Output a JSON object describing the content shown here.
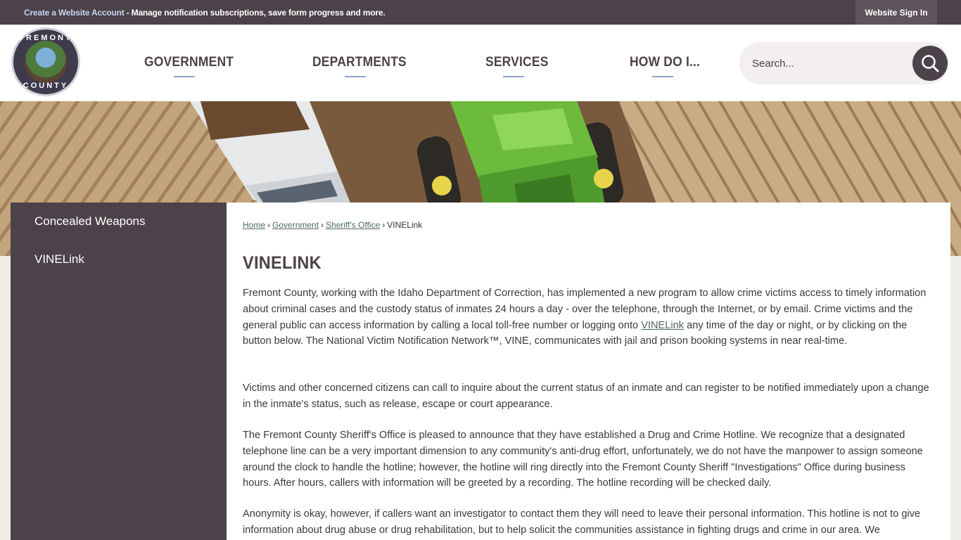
{
  "topbar": {
    "account_link": "Create a Website Account",
    "account_rest": " - Manage notification subscriptions, save form progress and more.",
    "signin_label": "Website Sign In"
  },
  "logo": {
    "top_text": "FREMONT",
    "bottom_text": "COUNTY"
  },
  "nav": {
    "items": [
      {
        "label": "GOVERNMENT"
      },
      {
        "label": "DEPARTMENTS"
      },
      {
        "label": "SERVICES"
      },
      {
        "label": "HOW DO I..."
      }
    ]
  },
  "search": {
    "placeholder": "Search..."
  },
  "sidebar": {
    "items": [
      {
        "label": "Concealed Weapons"
      },
      {
        "label": "VINELink"
      }
    ]
  },
  "breadcrumb": {
    "home": "Home",
    "government": "Government",
    "sheriffs_office": "Sheriff's Office",
    "current": "VINELink",
    "separator": "›"
  },
  "page": {
    "title": "VINELINK",
    "p1_a": "Fremont County, working with the Idaho Department of Correction, has implemented a new program to allow crime victims access to timely information about criminal cases and the custody status of inmates 24 hours a day - over the telephone, through the Internet, or by email. Crime victims and the general public can access information by calling a local toll-free number or logging onto ",
    "p1_link": "VINELink",
    "p1_b": " any time of the day or night, or by clicking on the button below. The National Victim Notification Network™, VINE, communicates with jail and prison booking systems in near real-time.",
    "p2": "Victims and other concerned citizens can call to inquire about the current status of an inmate and can register to be notified immediately upon a change in the inmate's status, such as release, escape or court appearance.",
    "p3": "The Fremont County Sheriff's Office is pleased to announce that they have established a Drug and Crime Hotline. We recognize that a designated telephone line can be a very important dimension to any community's anti-drug effort, unfortunately, we do not have the manpower to assign someone around the clock to handle the hotline; however, the hotline will ring directly into the Fremont County Sheriff \"Investigations\" Office during business hours. After hours, callers with information will be greeted by a recording. The hotline recording will be checked daily.",
    "p4": "Anonymity is okay, however, if callers want an investigator to contact them they will need to leave their personal information. This hotline is not to give information about drug abuse or drug rehabilitation, but to help solicit the communities assistance in fighting drugs and crime in our area. We"
  },
  "colors": {
    "brand_dark": "#4c4249",
    "nav_accent": "#8da3cf",
    "link": "#4d6b5a"
  }
}
